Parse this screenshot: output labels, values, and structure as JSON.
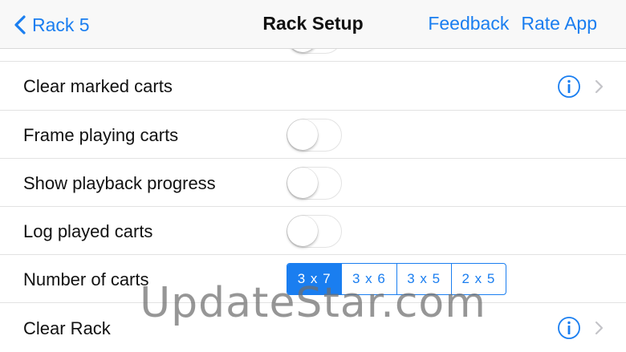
{
  "navbar": {
    "back_label": "Rack 5",
    "title": "Rack Setup",
    "feedback_label": "Feedback",
    "rate_label": "Rate App"
  },
  "rows": {
    "clear_marked": {
      "label": "Clear marked carts"
    },
    "frame_playing": {
      "label": "Frame playing carts",
      "toggle_on": false
    },
    "show_progress": {
      "label": "Show playback progress",
      "toggle_on": false
    },
    "log_played": {
      "label": "Log played carts",
      "toggle_on": false
    },
    "number_of_carts": {
      "label": "Number of carts",
      "options": [
        "3 x 7",
        "3 x 6",
        "3 x 5",
        "2 x 5"
      ],
      "selected": "3 x 7"
    },
    "clear_rack": {
      "label": "Clear Rack"
    }
  },
  "watermark": "UpdateStar.com",
  "colors": {
    "accent": "#1a7ef0",
    "navbar_bg": "#f8f8f8",
    "separator": "#e2e2e2"
  },
  "icons": {
    "back": "chevron-left-icon",
    "info": "info-circle-icon",
    "disclosure": "chevron-right-icon"
  }
}
